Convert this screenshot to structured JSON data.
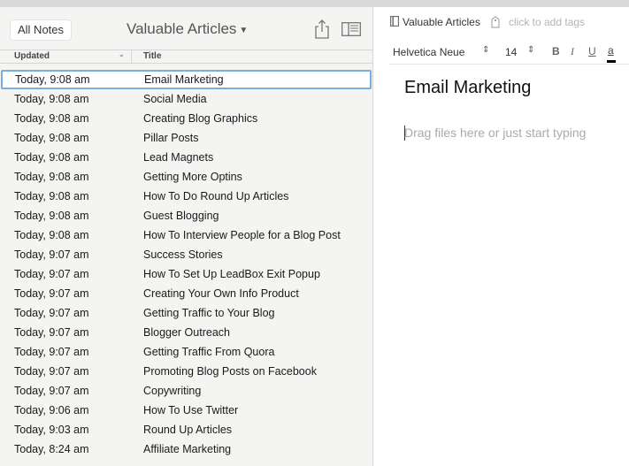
{
  "list_pane": {
    "all_notes_label": "All Notes",
    "notebook_title": "Valuable Articles",
    "columns": {
      "updated": "Updated",
      "title": "Title"
    },
    "notes": [
      {
        "updated": "Today, 9:08 am",
        "title": "Email Marketing",
        "selected": true
      },
      {
        "updated": "Today, 9:08 am",
        "title": "Social Media"
      },
      {
        "updated": "Today, 9:08 am",
        "title": "Creating Blog Graphics"
      },
      {
        "updated": "Today, 9:08 am",
        "title": "Pillar Posts"
      },
      {
        "updated": "Today, 9:08 am",
        "title": "Lead Magnets"
      },
      {
        "updated": "Today, 9:08 am",
        "title": "Getting More Optins"
      },
      {
        "updated": "Today, 9:08 am",
        "title": "How To Do Round Up Articles"
      },
      {
        "updated": "Today, 9:08 am",
        "title": "Guest Blogging"
      },
      {
        "updated": "Today, 9:08 am",
        "title": "How To Interview People for a Blog Post"
      },
      {
        "updated": "Today, 9:07 am",
        "title": "Success Stories"
      },
      {
        "updated": "Today, 9:07 am",
        "title": "How To Set Up LeadBox Exit Popup"
      },
      {
        "updated": "Today, 9:07 am",
        "title": "Creating Your Own Info Product"
      },
      {
        "updated": "Today, 9:07 am",
        "title": "Getting Traffic to Your Blog"
      },
      {
        "updated": "Today, 9:07 am",
        "title": "Blogger Outreach"
      },
      {
        "updated": "Today, 9:07 am",
        "title": "Getting Traffic From Quora"
      },
      {
        "updated": "Today, 9:07 am",
        "title": "Promoting Blog Posts on Facebook"
      },
      {
        "updated": "Today, 9:07 am",
        "title": "Copywriting"
      },
      {
        "updated": "Today, 9:06 am",
        "title": "How To Use Twitter"
      },
      {
        "updated": "Today, 9:03 am",
        "title": "Round Up Articles"
      },
      {
        "updated": "Today, 8:24 am",
        "title": "Affiliate Marketing"
      }
    ]
  },
  "editor": {
    "notebook_label": "Valuable Articles",
    "tags_placeholder": "click to add tags",
    "font_name": "Helvetica Neue",
    "font_size": "14",
    "bold_label": "B",
    "italic_label": "I",
    "underline_label": "U",
    "color_label": "a",
    "note_title": "Email Marketing",
    "body_placeholder": "Drag files here or just start typing"
  },
  "colors": {
    "selection_outline": "#79aee3",
    "list_background": "#f4f4f2"
  }
}
